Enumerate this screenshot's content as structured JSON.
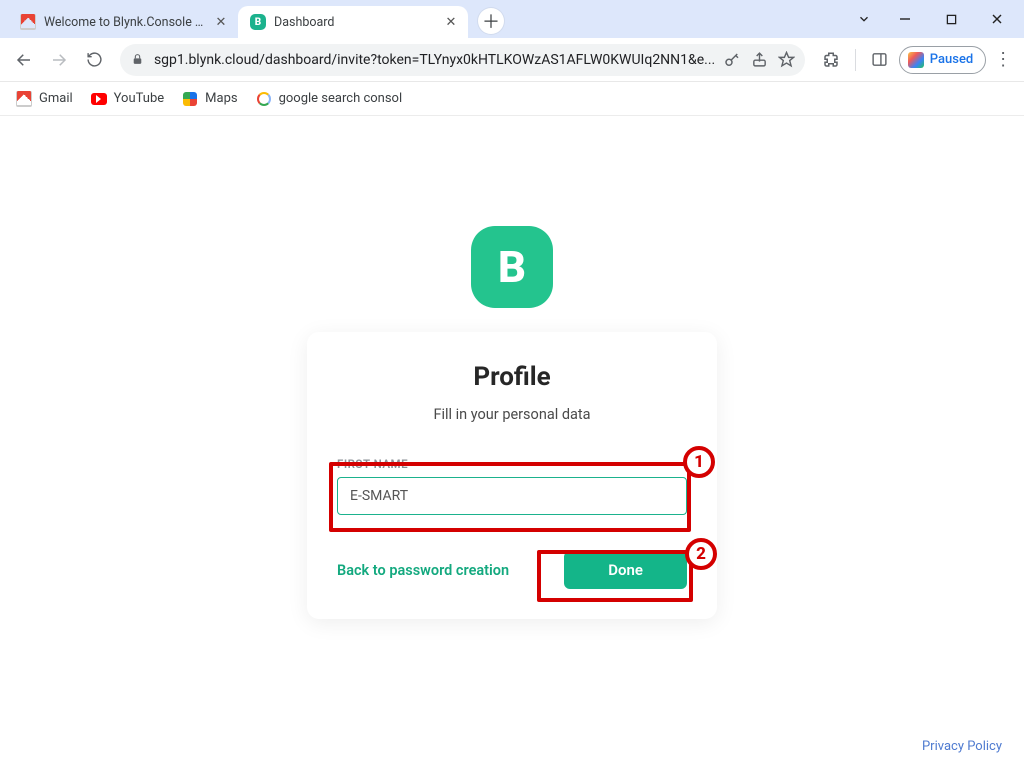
{
  "window": {
    "tabs": [
      {
        "title": "Welcome to Blynk.Console - ho",
        "active": false,
        "favicon": "gmail"
      },
      {
        "title": "Dashboard",
        "active": true,
        "favicon": "blynk"
      }
    ]
  },
  "toolbar": {
    "url": "sgp1.blynk.cloud/dashboard/invite?token=TLYnyx0kHTLKOWzAS1AFLW0KWUIq2NN1&e...",
    "paused_label": "Paused"
  },
  "bookmarks": {
    "items": [
      {
        "label": "Gmail",
        "icon": "gmail"
      },
      {
        "label": "YouTube",
        "icon": "youtube"
      },
      {
        "label": "Maps",
        "icon": "maps"
      },
      {
        "label": "google search consol",
        "icon": "google"
      }
    ]
  },
  "page": {
    "logo_letter": "B",
    "card": {
      "heading": "Profile",
      "subtitle": "Fill in your personal data",
      "first_name_label": "FIRST NAME",
      "first_name_value": "E-SMART",
      "back_label": "Back to password creation",
      "done_label": "Done"
    },
    "annotations": {
      "badge1": "1",
      "badge2": "2"
    },
    "footer": {
      "privacy": "Privacy Policy"
    }
  }
}
